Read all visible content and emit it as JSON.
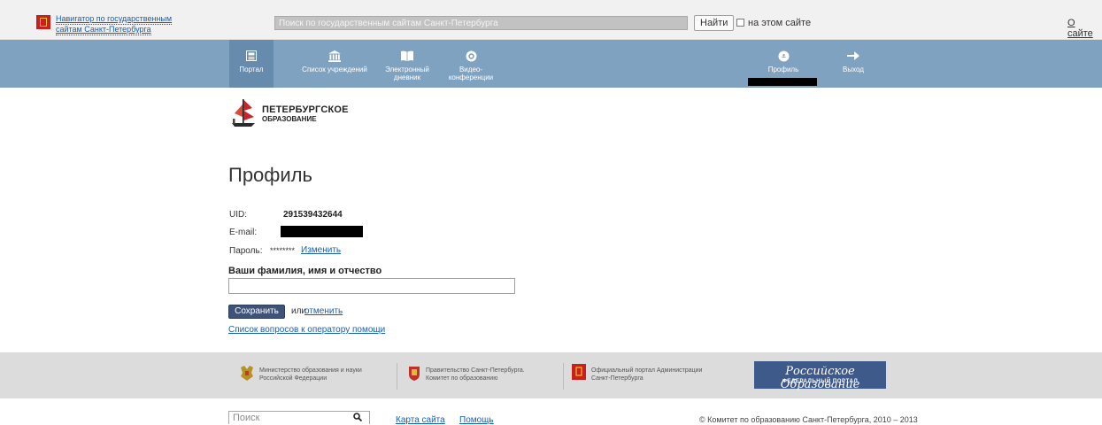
{
  "gov_bar": {
    "navigator_line1": "Навигатор по государственным",
    "navigator_line2": "сайтам Санкт-Петербурга",
    "search_placeholder": "Поиск по государственным сайтам Санкт-Петербурга",
    "find_button": "Найти",
    "this_site_label": "на этом сайте",
    "this_site_checked": false,
    "about_link": "О сайте"
  },
  "nav": {
    "items": [
      {
        "label": "Портал",
        "icon": "portal-icon",
        "active": true
      },
      {
        "label": "Список учреждений",
        "icon": "institution-icon",
        "active": false
      },
      {
        "label_line1": "Электронный",
        "label_line2": "дневник",
        "icon": "book-icon",
        "active": false
      },
      {
        "label_line1": "Видео-",
        "label_line2": "конференции",
        "icon": "video-icon",
        "active": false
      }
    ],
    "profile_label": "Профиль",
    "logout_label": "Выход"
  },
  "logo": {
    "line1": "ПЕТЕРБУРГСКОЕ",
    "line2": "ОБРАЗОВАНИЕ"
  },
  "profile": {
    "title": "Профиль",
    "uid_label": "UID:",
    "uid_value": "291539432644",
    "email_label": "E-mail:",
    "password_label": "Пароль:",
    "password_value": "********",
    "change_link": "Изменить",
    "fio_label": "Ваши фамилия, имя и отчество",
    "fio_value": "",
    "save_button": "Сохранить",
    "or_text": "или",
    "cancel_link": "отменить",
    "help_link": "Список вопросов к оператору помощи"
  },
  "partners": [
    {
      "line1": "Министерство образования и науки",
      "line2": "Российской Федерации",
      "icon": "russia-emblem-icon"
    },
    {
      "line1": "Правительство Санкт-Петербурга.",
      "line2": "Комитет по образованию",
      "icon": "spb-emblem-icon"
    },
    {
      "line1": "Официальный портал Администрации",
      "line2": "Санкт-Петербурга",
      "icon": "spb-flag-icon"
    }
  ],
  "banner": {
    "title": "Российское Образование",
    "subtitle": "ФЕДЕРАЛЬНЫЙ ПОРТАЛ"
  },
  "footer": {
    "search_placeholder": "Поиск",
    "sitemap_link": "Карта сайта",
    "help_link": "Помощь",
    "copyright": "© Комитет по образованию Санкт-Петербурга, 2010 – 2013"
  },
  "colors": {
    "nav_bg": "#7fa2c0",
    "nav_active": "#668bad",
    "link": "#1a5fae",
    "save_button": "#3f5277",
    "partners_bg": "#dcdcdc"
  }
}
